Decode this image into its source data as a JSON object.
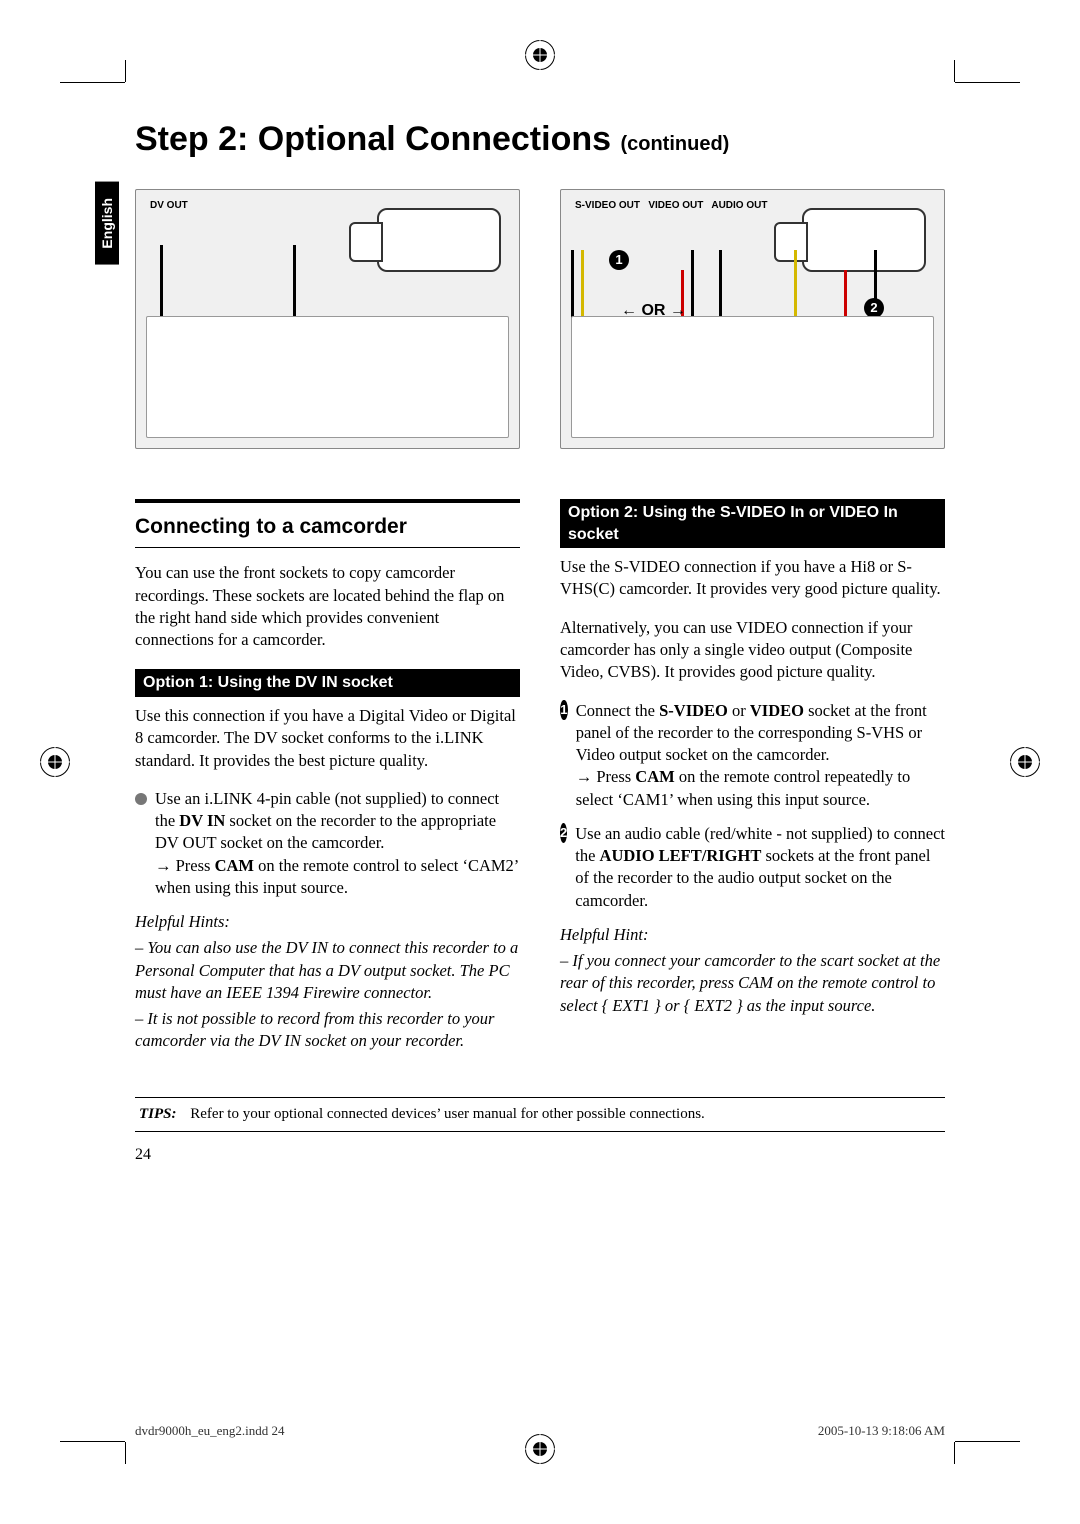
{
  "page": {
    "title_main": "Step 2: Optional Connections ",
    "title_cont": "(continued)",
    "side_tab": "English",
    "page_number": "24"
  },
  "diagram1": {
    "label": "DV OUT"
  },
  "diagram2": {
    "label_sv": "S-VIDEO OUT",
    "label_v": "VIDEO OUT",
    "label_a": "AUDIO OUT",
    "or": "OR",
    "n1": "1",
    "n2": "2"
  },
  "left": {
    "h2": "Connecting to a camcorder",
    "intro": "You can use the front sockets to copy camcorder recordings. These sockets are located behind the flap on the right hand side which provides convenient connections for a camcorder.",
    "opt1_head": "Option 1: Using the DV IN socket",
    "opt1_p": "Use this connection if you have a Digital Video or Digital 8 camcorder. The DV socket conforms to the i.LINK standard. It provides the best picture quality.",
    "opt1_b_pre": "Use an i.LINK 4-pin cable (not supplied) to connect the ",
    "opt1_b_bold": "DV IN",
    "opt1_b_post": " socket on the recorder to the appropriate DV OUT socket on the camcorder.",
    "opt1_arrow_pre": "Press ",
    "opt1_arrow_bold": "CAM",
    "opt1_arrow_post": " on the remote control to select ‘CAM2’ when using this input source.",
    "hints_label": "Helpful Hints:",
    "hint1": "– You can also use the DV IN to connect this recorder to a Personal Computer that has a DV output socket. The PC must have an IEEE 1394 Firewire connector.",
    "hint2": "– It is not possible to record from this recorder to your camcorder via the DV IN socket on your recorder."
  },
  "right": {
    "opt2_head": "Option 2: Using the S-VIDEO In or VIDEO In socket",
    "opt2_p1": "Use the S-VIDEO connection if you have a Hi8 or S-VHS(C) camcorder. It provides very good picture quality.",
    "opt2_p2": "Alternatively, you can use VIDEO connection if your camcorder has only a single video output (Composite Video, CVBS). It provides good picture quality.",
    "s1_n": "1",
    "s1_pre": "Connect the ",
    "s1_b1": "S-VIDEO",
    "s1_mid": " or ",
    "s1_b2": "VIDEO",
    "s1_post": " socket at the front panel of the recorder to the corresponding S-VHS or Video output socket on the camcorder.",
    "s1_arrow_pre": "Press ",
    "s1_arrow_bold": "CAM",
    "s1_arrow_post": " on the remote control repeatedly to select ‘CAM1’ when using this input source.",
    "s2_n": "2",
    "s2_pre": "Use an audio cable (red/white - not supplied) to connect the ",
    "s2_bold": "AUDIO LEFT/RIGHT",
    "s2_post": " sockets at the front panel of the recorder to the audio output socket on the camcorder.",
    "hint_label": "Helpful Hint:",
    "hint": "– If you connect your camcorder to the scart socket at the rear of this recorder, press CAM on the remote control to select { EXT1 } or { EXT2 } as the input source."
  },
  "tips": {
    "label": "TIPS:",
    "text": "Refer to your optional connected devices’ user manual for other possible connections."
  },
  "footer": {
    "left": "dvdr9000h_eu_eng2.indd   24",
    "right": "2005-10-13   9:18:06 AM"
  }
}
